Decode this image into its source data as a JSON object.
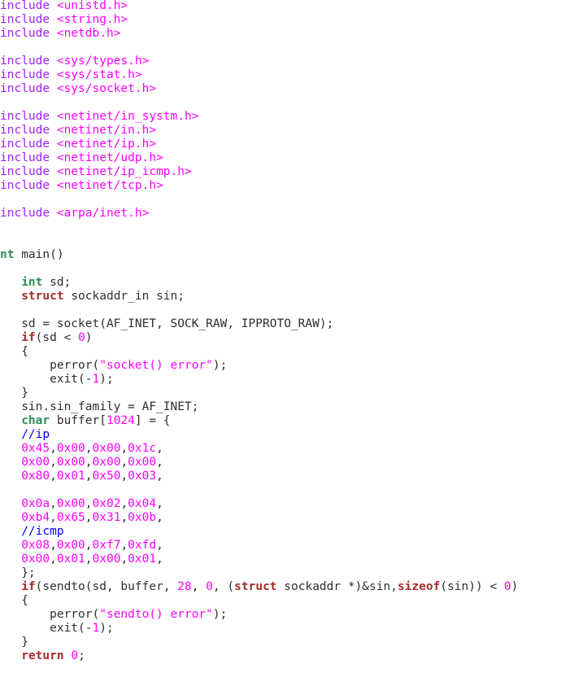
{
  "colors": {
    "preprocessor": "#a020f0",
    "string": "#ff00ff",
    "number": "#ff00ff",
    "type": "#2e8b57",
    "keyword": "#a52a2a",
    "comment": "#0000ff",
    "text": "#2e2e2e",
    "background": "#ffffff"
  },
  "code": {
    "lines": [
      [
        [
          "pre",
          "include "
        ],
        [
          "str",
          "<unistd.h>"
        ]
      ],
      [
        [
          "pre",
          "include "
        ],
        [
          "str",
          "<string.h>"
        ]
      ],
      [
        [
          "pre",
          "include "
        ],
        [
          "str",
          "<netdb.h>"
        ]
      ],
      [],
      [
        [
          "pre",
          "include "
        ],
        [
          "str",
          "<sys/types.h>"
        ]
      ],
      [
        [
          "pre",
          "include "
        ],
        [
          "str",
          "<sys/stat.h>"
        ]
      ],
      [
        [
          "pre",
          "include "
        ],
        [
          "str",
          "<sys/socket.h>"
        ]
      ],
      [],
      [
        [
          "pre",
          "include "
        ],
        [
          "str",
          "<netinet/in_systm.h>"
        ]
      ],
      [
        [
          "pre",
          "include "
        ],
        [
          "str",
          "<netinet/in.h>"
        ]
      ],
      [
        [
          "pre",
          "include "
        ],
        [
          "str",
          "<netinet/ip.h>"
        ]
      ],
      [
        [
          "pre",
          "include "
        ],
        [
          "str",
          "<netinet/udp.h>"
        ]
      ],
      [
        [
          "pre",
          "include "
        ],
        [
          "str",
          "<netinet/ip_icmp.h>"
        ]
      ],
      [
        [
          "pre",
          "include "
        ],
        [
          "str",
          "<netinet/tcp.h>"
        ]
      ],
      [],
      [
        [
          "pre",
          "include "
        ],
        [
          "str",
          "<arpa/inet.h>"
        ]
      ],
      [],
      [],
      [
        [
          "type",
          "nt"
        ],
        [
          "txt",
          " main()"
        ]
      ],
      [],
      [
        [
          "txt",
          "   "
        ],
        [
          "type",
          "int"
        ],
        [
          "txt",
          " sd;"
        ]
      ],
      [
        [
          "txt",
          "   "
        ],
        [
          "kw",
          "struct"
        ],
        [
          "txt",
          " sockaddr_in sin;"
        ]
      ],
      [],
      [
        [
          "txt",
          "   sd = socket(AF_INET, SOCK_RAW, IPPROTO_RAW);"
        ]
      ],
      [
        [
          "txt",
          "   "
        ],
        [
          "kw",
          "if"
        ],
        [
          "txt",
          "(sd < "
        ],
        [
          "num",
          "0"
        ],
        [
          "txt",
          ")"
        ]
      ],
      [
        [
          "txt",
          "   {"
        ]
      ],
      [
        [
          "txt",
          "       perror("
        ],
        [
          "str",
          "\"socket() error\""
        ],
        [
          "txt",
          ");"
        ]
      ],
      [
        [
          "txt",
          "       exit(-"
        ],
        [
          "num",
          "1"
        ],
        [
          "txt",
          ");"
        ]
      ],
      [
        [
          "txt",
          "   }"
        ]
      ],
      [
        [
          "txt",
          "   sin.sin_family = AF_INET;"
        ]
      ],
      [
        [
          "txt",
          "   "
        ],
        [
          "type",
          "char"
        ],
        [
          "txt",
          " buffer["
        ],
        [
          "num",
          "1024"
        ],
        [
          "txt",
          "] = {"
        ]
      ],
      [
        [
          "txt",
          "   "
        ],
        [
          "com",
          "//ip"
        ]
      ],
      [
        [
          "txt",
          "   "
        ],
        [
          "num",
          "0x45"
        ],
        [
          "txt",
          ","
        ],
        [
          "num",
          "0x00"
        ],
        [
          "txt",
          ","
        ],
        [
          "num",
          "0x00"
        ],
        [
          "txt",
          ","
        ],
        [
          "num",
          "0x1c"
        ],
        [
          "txt",
          ","
        ]
      ],
      [
        [
          "txt",
          "   "
        ],
        [
          "num",
          "0x00"
        ],
        [
          "txt",
          ","
        ],
        [
          "num",
          "0x00"
        ],
        [
          "txt",
          ","
        ],
        [
          "num",
          "0x00"
        ],
        [
          "txt",
          ","
        ],
        [
          "num",
          "0x00"
        ],
        [
          "txt",
          ","
        ]
      ],
      [
        [
          "txt",
          "   "
        ],
        [
          "num",
          "0x80"
        ],
        [
          "txt",
          ","
        ],
        [
          "num",
          "0x01"
        ],
        [
          "txt",
          ","
        ],
        [
          "num",
          "0x50"
        ],
        [
          "txt",
          ","
        ],
        [
          "num",
          "0x03"
        ],
        [
          "txt",
          ","
        ]
      ],
      [],
      [
        [
          "txt",
          "   "
        ],
        [
          "num",
          "0x0a"
        ],
        [
          "txt",
          ","
        ],
        [
          "num",
          "0x00"
        ],
        [
          "txt",
          ","
        ],
        [
          "num",
          "0x02"
        ],
        [
          "txt",
          ","
        ],
        [
          "num",
          "0x04"
        ],
        [
          "txt",
          ","
        ]
      ],
      [
        [
          "txt",
          "   "
        ],
        [
          "num",
          "0xb4"
        ],
        [
          "txt",
          ","
        ],
        [
          "num",
          "0x65"
        ],
        [
          "txt",
          ","
        ],
        [
          "num",
          "0x31"
        ],
        [
          "txt",
          ","
        ],
        [
          "num",
          "0x0b"
        ],
        [
          "txt",
          ","
        ]
      ],
      [
        [
          "txt",
          "   "
        ],
        [
          "com",
          "//icmp"
        ]
      ],
      [
        [
          "txt",
          "   "
        ],
        [
          "num",
          "0x08"
        ],
        [
          "txt",
          ","
        ],
        [
          "num",
          "0x00"
        ],
        [
          "txt",
          ","
        ],
        [
          "num",
          "0xf7"
        ],
        [
          "txt",
          ","
        ],
        [
          "num",
          "0xfd"
        ],
        [
          "txt",
          ","
        ]
      ],
      [
        [
          "txt",
          "   "
        ],
        [
          "num",
          "0x00"
        ],
        [
          "txt",
          ","
        ],
        [
          "num",
          "0x01"
        ],
        [
          "txt",
          ","
        ],
        [
          "num",
          "0x00"
        ],
        [
          "txt",
          ","
        ],
        [
          "num",
          "0x01"
        ],
        [
          "txt",
          ","
        ]
      ],
      [
        [
          "txt",
          "   };"
        ]
      ],
      [
        [
          "txt",
          "   "
        ],
        [
          "kw",
          "if"
        ],
        [
          "txt",
          "(sendto(sd, buffer, "
        ],
        [
          "num",
          "28"
        ],
        [
          "txt",
          ", "
        ],
        [
          "num",
          "0"
        ],
        [
          "txt",
          ", ("
        ],
        [
          "kw",
          "struct"
        ],
        [
          "txt",
          " sockaddr *)&sin,"
        ],
        [
          "kw",
          "sizeof"
        ],
        [
          "txt",
          "(sin)) < "
        ],
        [
          "num",
          "0"
        ],
        [
          "txt",
          ")"
        ]
      ],
      [
        [
          "txt",
          "   {"
        ]
      ],
      [
        [
          "txt",
          "       perror("
        ],
        [
          "str",
          "\"sendto() error\""
        ],
        [
          "txt",
          ");"
        ]
      ],
      [
        [
          "txt",
          "       exit(-"
        ],
        [
          "num",
          "1"
        ],
        [
          "txt",
          ");"
        ]
      ],
      [
        [
          "txt",
          "   }"
        ]
      ],
      [
        [
          "txt",
          "   "
        ],
        [
          "kw",
          "return"
        ],
        [
          "txt",
          " "
        ],
        [
          "num",
          "0"
        ],
        [
          "txt",
          ";"
        ]
      ]
    ]
  }
}
